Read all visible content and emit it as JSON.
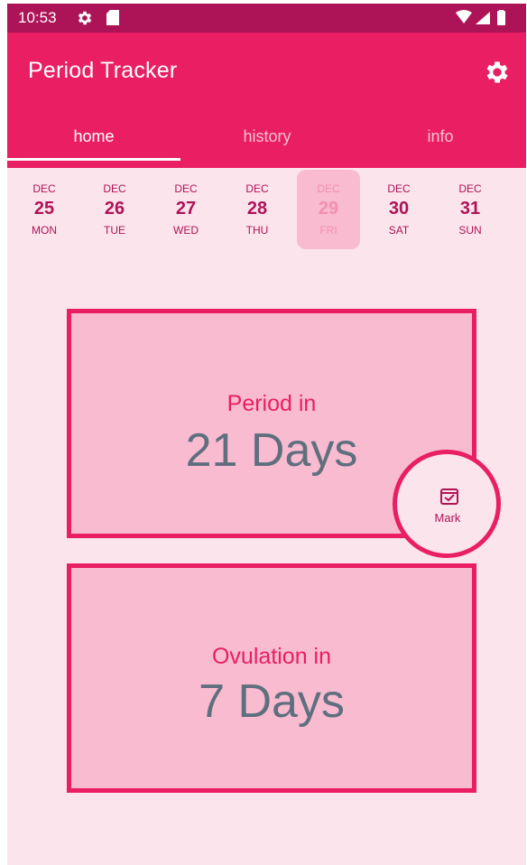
{
  "status_bar": {
    "time": "10:53",
    "icons": [
      "gear-icon",
      "sd-card-icon",
      "wifi-icon",
      "signal-icon",
      "battery-icon"
    ]
  },
  "app_bar": {
    "title": "Period Tracker",
    "settings_icon": "gear-icon"
  },
  "tabs": [
    {
      "label": "home",
      "active": true
    },
    {
      "label": "history",
      "active": false
    },
    {
      "label": "info",
      "active": false
    }
  ],
  "days": [
    {
      "month": "DEC",
      "day": "25",
      "weekday": "MON",
      "selected": false
    },
    {
      "month": "DEC",
      "day": "26",
      "weekday": "TUE",
      "selected": false
    },
    {
      "month": "DEC",
      "day": "27",
      "weekday": "WED",
      "selected": false
    },
    {
      "month": "DEC",
      "day": "28",
      "weekday": "THU",
      "selected": false
    },
    {
      "month": "DEC",
      "day": "29",
      "weekday": "FRI",
      "selected": true
    },
    {
      "month": "DEC",
      "day": "30",
      "weekday": "SAT",
      "selected": false
    },
    {
      "month": "DEC",
      "day": "31",
      "weekday": "SUN",
      "selected": false
    }
  ],
  "period_card": {
    "label": "Period in",
    "value": "21 Days"
  },
  "mark_button": {
    "label": "Mark",
    "icon": "calendar-check-icon"
  },
  "ovulation_card": {
    "label": "Ovulation in",
    "value": "7 Days"
  },
  "colors": {
    "primary": "#e91e63",
    "primary_dark": "#ad1457",
    "background": "#fce4ec",
    "card": "#f8bbd0",
    "value_text": "#5f6f7e"
  }
}
